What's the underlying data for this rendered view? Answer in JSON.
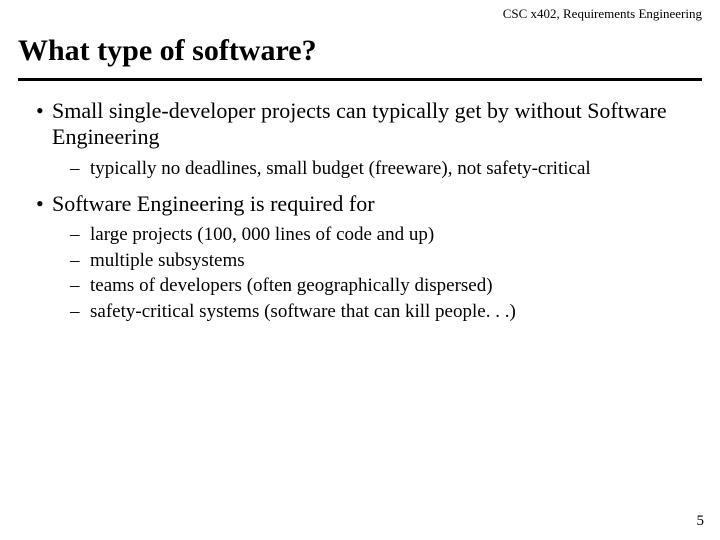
{
  "header": "CSC x402, Requirements Engineering",
  "title": "What type of software?",
  "bullets": [
    {
      "text": "Small single-developer projects can typically get by without Software Engineering",
      "sub": [
        "typically no deadlines, small budget (freeware), not safety-critical"
      ]
    },
    {
      "text": "Software Engineering is required for",
      "sub": [
        "large projects (100, 000 lines of code and up)",
        "multiple subsystems",
        "teams of developers (often geographically dispersed)",
        "safety-critical systems (software that can kill people. . .)"
      ]
    }
  ],
  "pageNumber": "5"
}
